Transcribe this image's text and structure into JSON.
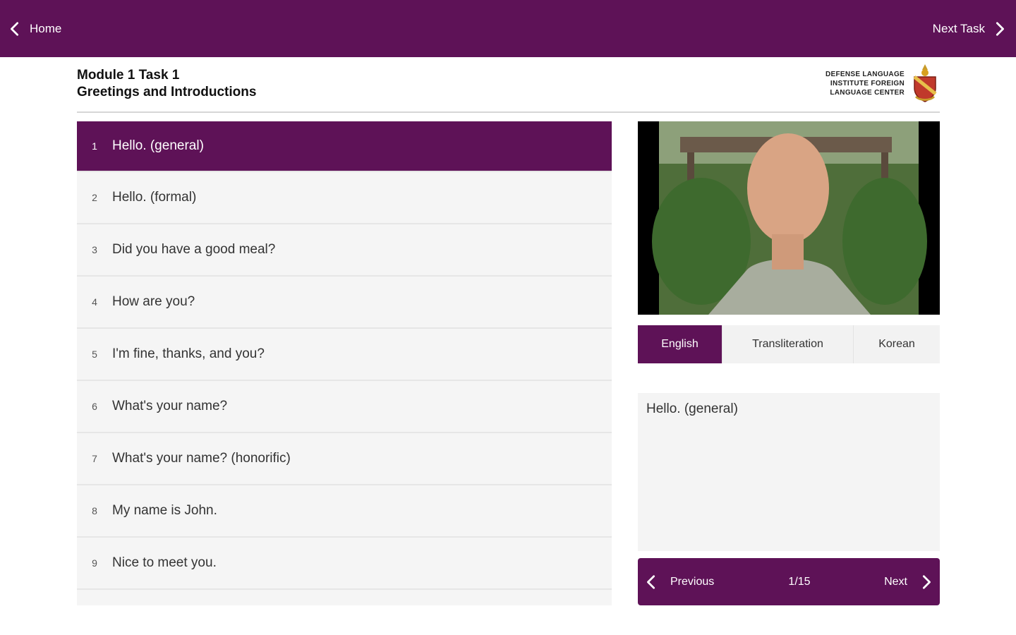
{
  "topbar": {
    "home_label": "Home",
    "next_task_label": "Next Task",
    "color": "#5e1257"
  },
  "module": {
    "title": "Module 1 Task 1",
    "subtitle": "Greetings and Introductions"
  },
  "logo": {
    "line1": "DEFENSE LANGUAGE",
    "line2": "INSTITUTE FOREIGN",
    "line3": "LANGUAGE CENTER",
    "icon": "crest-icon"
  },
  "phrases": [
    {
      "num": "1",
      "text": "Hello. (general)"
    },
    {
      "num": "2",
      "text": "Hello. (formal)"
    },
    {
      "num": "3",
      "text": "Did you have a good meal?"
    },
    {
      "num": "4",
      "text": "How are you?"
    },
    {
      "num": "5",
      "text": "I'm fine, thanks, and you?"
    },
    {
      "num": "6",
      "text": "What's your name?"
    },
    {
      "num": "7",
      "text": "What's your name?  (honorific)"
    },
    {
      "num": "8",
      "text": "My name is John."
    },
    {
      "num": "9",
      "text": "Nice to meet you."
    }
  ],
  "tabs": {
    "english": "English",
    "transliteration": "Transliteration",
    "korean": "Korean"
  },
  "display_text": "Hello. (general)",
  "pager": {
    "previous_label": "Previous",
    "count": "1/15",
    "next_label": "Next"
  }
}
